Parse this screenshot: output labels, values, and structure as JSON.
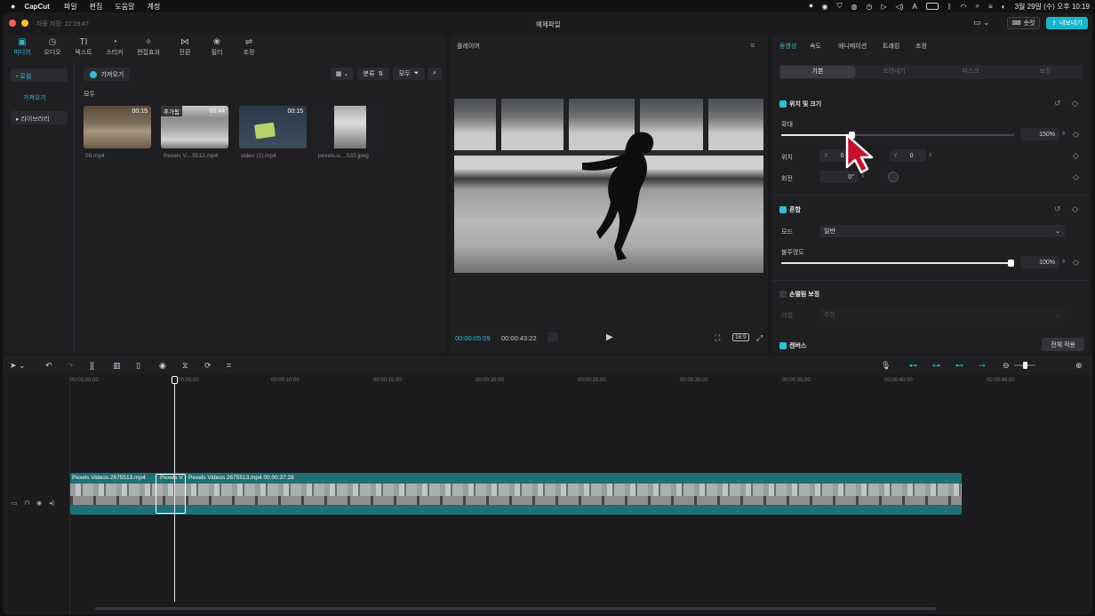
{
  "menubar": {
    "apple": "",
    "app": "CapCut",
    "items": [
      "파일",
      "편집",
      "도움말",
      "계정"
    ],
    "datetime": "3월 29일 (수) 오후 10:19",
    "status_icons": [
      "record-icon",
      "camera-icon",
      "shield-icon",
      "bell-icon",
      "volume-icon",
      "battery-icon",
      "wifi-icon",
      "search-icon"
    ]
  },
  "titlebar": {
    "autosave": "자동 저장: 22:19:47",
    "project": "예제파일",
    "shortcut": "숏컷",
    "export": "내보내기"
  },
  "media": {
    "tabs": [
      {
        "icon": "▣",
        "label": "미디어"
      },
      {
        "icon": "◷",
        "label": "오디오"
      },
      {
        "icon": "TI",
        "label": "텍스트"
      },
      {
        "icon": "◔",
        "label": "스티커"
      },
      {
        "icon": "✧",
        "label": "편집효과"
      },
      {
        "icon": "⋈",
        "label": "전환"
      },
      {
        "icon": "❀",
        "label": "필터"
      },
      {
        "icon": "⇌",
        "label": "조정"
      }
    ],
    "side": [
      "• 로컬",
      "가져오기",
      "▸ 라이브러리"
    ],
    "import_button": "가져오기",
    "sort_label": "분류",
    "filter_label": "모두",
    "section": "모두",
    "items": [
      {
        "name": "09.mp4",
        "duration": "00:15",
        "badge": ""
      },
      {
        "name": "Pexels V....5513.mp4",
        "duration": "00:44",
        "badge": "추가됨"
      },
      {
        "name": "video (1).mp4",
        "duration": "00:15",
        "badge": ""
      },
      {
        "name": "pexels-u....533.jpeg",
        "duration": "",
        "badge": ""
      }
    ]
  },
  "player": {
    "title": "플레이어",
    "current": "00:00:05:09",
    "total": "00:00:43:22",
    "ratio": "16:9"
  },
  "props": {
    "tabs": [
      "동영상",
      "속도",
      "애니메이션",
      "트래킹",
      "조정"
    ],
    "subtabs": [
      "기본",
      "오려내기",
      "마스크",
      "보정"
    ],
    "pos_size": "위치 및 크기",
    "scale_label": "확대",
    "scale_value": "150%",
    "scale_fraction": 0.3,
    "position_label": "위치",
    "x_label": "X",
    "x_value": "0",
    "y_label": "Y",
    "y_value": "0",
    "rotation_label": "회전",
    "rotation_value": "0°",
    "blend": "혼합",
    "mode_label": "모드",
    "mode_value": "일반",
    "opacity_label": "불투명도",
    "opacity_value": "100%",
    "opacity_fraction": 1.0,
    "stabilize": "손떨림 보정",
    "level_label": "레벨",
    "level_value": "추천",
    "canvas": "캔버스",
    "apply_all": "전체 적용"
  },
  "timeline": {
    "ticks": [
      "00:00:00:00",
      "00:00:05:00",
      "00:00:10:00",
      "00:00:15:00",
      "00:00:20:00",
      "00:00:25:00",
      "00:00:30:00",
      "00:00:35:00",
      "00:00:40:00",
      "00:00:45:00"
    ],
    "clip1": "Pexels Videos 2675513.mp4",
    "clip2": "Pexels V",
    "clip3": "Pexels Videos 2675513.mp4   00:00:37:28"
  },
  "colors": {
    "accent": "#2fc0d6",
    "clip": "#1f6f74",
    "export": "#19b5cc"
  }
}
